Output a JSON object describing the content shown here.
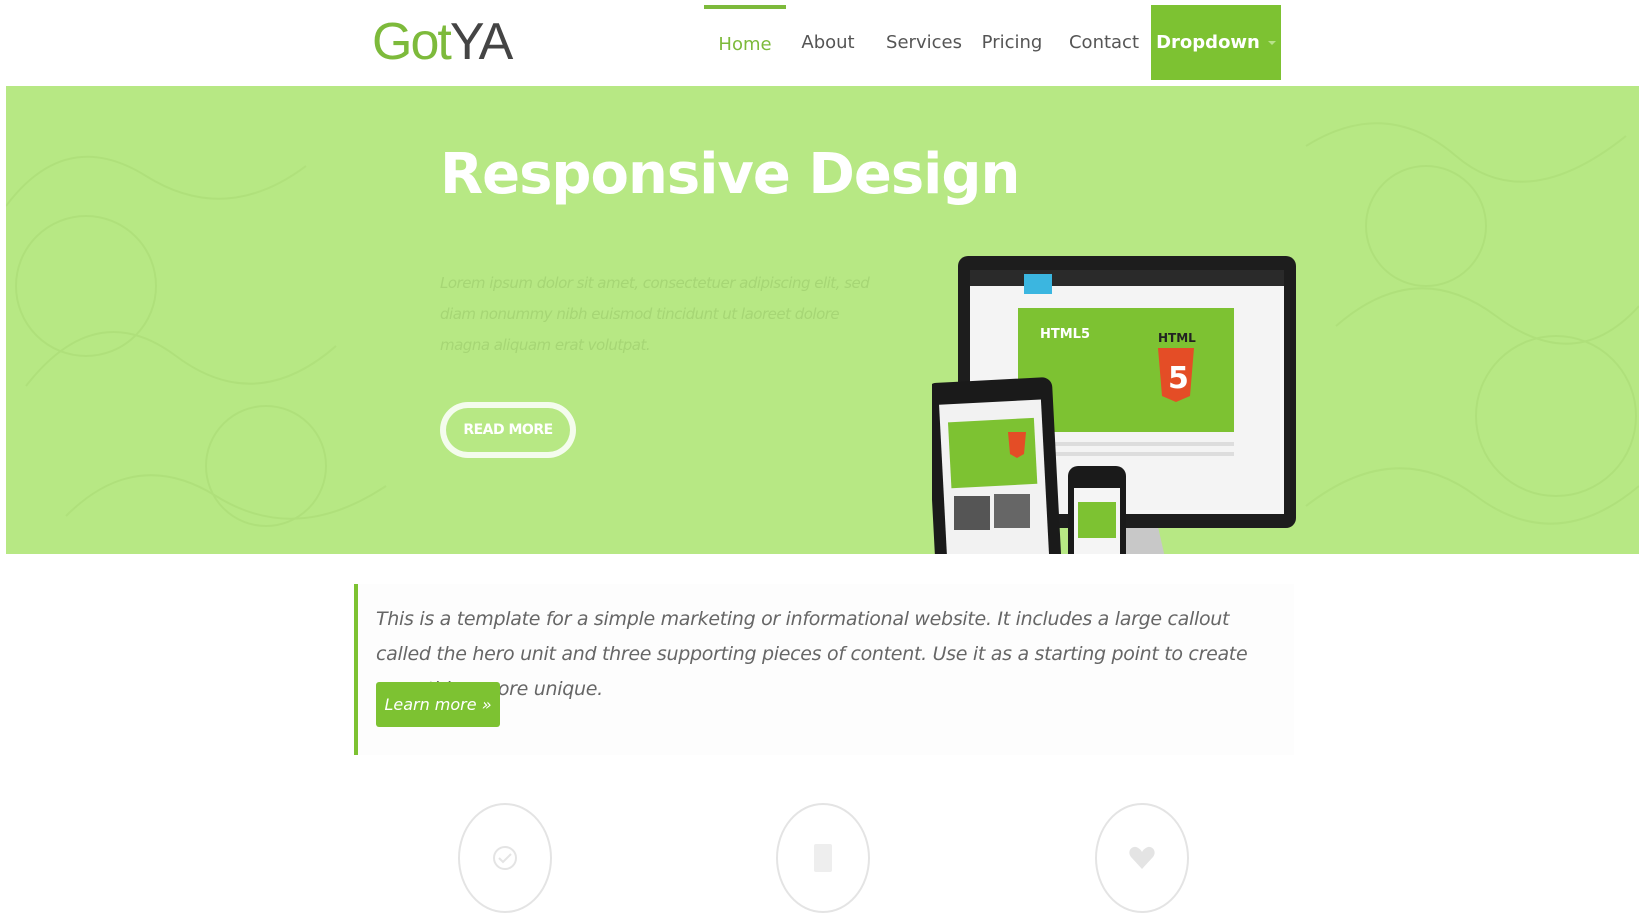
{
  "brand": {
    "part1": "Got",
    "part2": "YA"
  },
  "nav": {
    "items": [
      {
        "label": "Home"
      },
      {
        "label": "About"
      },
      {
        "label": "Services"
      },
      {
        "label": "Pricing"
      },
      {
        "label": "Contact"
      },
      {
        "label": "Dropdown"
      }
    ],
    "active": "Home"
  },
  "hero": {
    "title": "Responsive Design",
    "text": "Lorem ipsum dolor sit amet, consectetuer adipiscing elit, sed diam nonummy nibh euismod tincidunt ut laoreet dolore magna aliquam erat volutpat.",
    "button": "READ MORE",
    "slides_count": 4,
    "active_slide": 2,
    "device_labels": {
      "html5": "HTML5",
      "html": "HTML",
      "five": "5"
    }
  },
  "callout": {
    "text": "This is a template for a simple marketing or informational website. It includes a large callout called the hero unit and three supporting pieces of content. Use it as a starting point to create something more unique.",
    "button": "Learn more »"
  },
  "features": [
    {
      "icon": "check-circle-icon"
    },
    {
      "icon": "mobile-icon"
    },
    {
      "icon": "heart-icon"
    }
  ],
  "colors": {
    "accent": "#7dc232",
    "hero_bg": "#b7e884",
    "text": "#555555"
  }
}
